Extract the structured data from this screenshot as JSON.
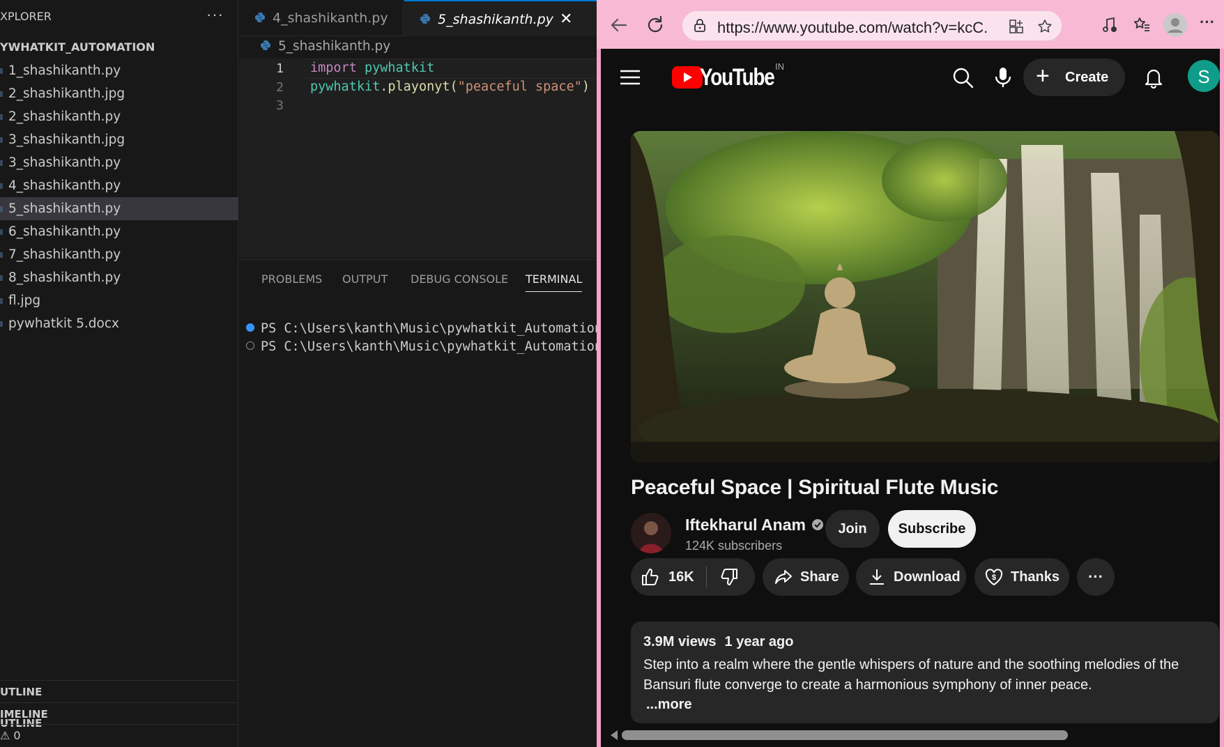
{
  "vscode": {
    "explorer_title": "XPLORER",
    "explorer_more": "···",
    "project": "YWHATKIT_AUTOMATION",
    "files": [
      {
        "name": "1_shashikanth.py",
        "active": false
      },
      {
        "name": "2_shashikanth.jpg",
        "active": false
      },
      {
        "name": "2_shashikanth.py",
        "active": false
      },
      {
        "name": "3_shashikanth.jpg",
        "active": false
      },
      {
        "name": "3_shashikanth.py",
        "active": false
      },
      {
        "name": "4_shashikanth.py",
        "active": false
      },
      {
        "name": "5_shashikanth.py",
        "active": true
      },
      {
        "name": "6_shashikanth.py",
        "active": false
      },
      {
        "name": "7_shashikanth.py",
        "active": false
      },
      {
        "name": "8_shashikanth.py",
        "active": false
      },
      {
        "name": "fl.jpg",
        "active": false
      },
      {
        "name": "pywhatkit 5.docx",
        "active": false
      }
    ],
    "outline": "UTLINE",
    "timeline": "IMELINE",
    "status_warnings": "⚠ 0",
    "tabs": [
      {
        "label": "4_shashikanth.py"
      },
      {
        "label": "5_shashikanth.py"
      }
    ],
    "tab_close": "✕",
    "breadcrumb": "5_shashikanth.py",
    "code": {
      "line1": {
        "num": "1",
        "kw": "import",
        "mod": "pywhatkit"
      },
      "line2": {
        "num": "2",
        "mod": "pywhatkit",
        "dot": ".",
        "fn": "playonyt",
        "open": "(",
        "str": "\"peaceful space\"",
        "close": ")"
      },
      "line3": {
        "num": "3"
      }
    },
    "panel_tabs": [
      "PROBLEMS",
      "OUTPUT",
      "DEBUG CONSOLE",
      "TERMINAL"
    ],
    "terminal": [
      "PS C:\\Users\\kanth\\Music\\pywhatkit_Automation",
      "PS C:\\Users\\kanth\\Music\\pywhatkit_Automation"
    ],
    "colors": {
      "accent": "#0078d4",
      "terminal_dot_active": "#3794ff"
    }
  },
  "browser": {
    "url": "https://www.youtube.com/watch?v=kcC...",
    "icons": [
      "back-icon",
      "refresh-icon",
      "lock-icon",
      "app-available-icon",
      "favorite-star-icon",
      "media-control-icon",
      "favorites-icon",
      "profile-icon",
      "more-icon"
    ],
    "frame_color": "#f4a4c8"
  },
  "youtube": {
    "logo_text": "YouTube",
    "region": "IN",
    "create_label": "Create",
    "avatar_letter": "S",
    "video_title": "Peaceful Space | Spiritual Flute Music",
    "channel_name": "Iftekharul Anam",
    "subscribers": "124K subscribers",
    "join_label": "Join",
    "subscribe_label": "Subscribe",
    "likes": "16K",
    "share_label": "Share",
    "download_label": "Download",
    "thanks_label": "Thanks",
    "more_label": "···",
    "views": "3.9M views",
    "age": "1 year ago",
    "description": "Step into a realm where the gentle whispers of nature and the soothing melodies of the Bansuri flute converge to create a harmonious symphony of inner peace.",
    "more_text": "...more"
  }
}
